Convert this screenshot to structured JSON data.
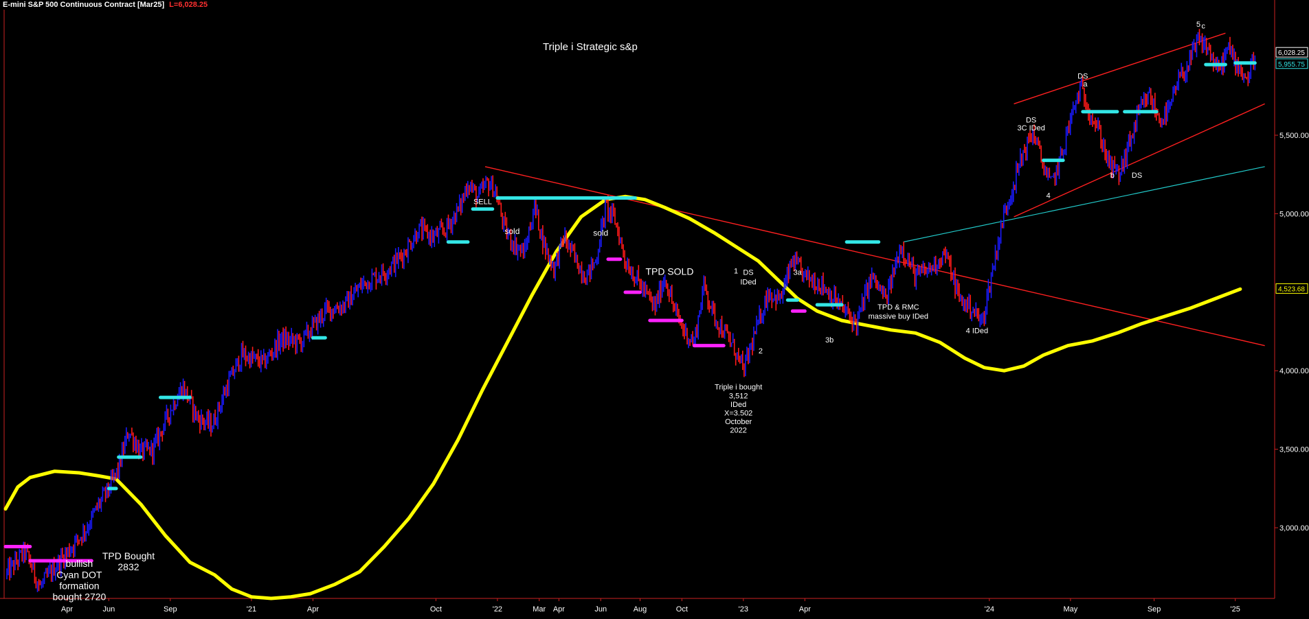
{
  "header": {
    "title": "E-mini S&P 500 Continuous Contract [Mar25]",
    "last_price": "L=6,028.25"
  },
  "colors": {
    "background": "#000000",
    "up_bar": "#1a1aff",
    "down_bar": "#ff1a1a",
    "moving_average": "#ffff00",
    "cyan_dots": "#33e6e6",
    "magenta_dots": "#ff22ff",
    "trendline_red": "#ff2020",
    "trendline_cyan": "#22cccc"
  },
  "chart_data": {
    "type": "line",
    "title": "Triple i Strategic  s&p",
    "xlabel": "",
    "ylabel": "",
    "x_ticks": [
      {
        "label": "Apr",
        "t": 2020.25
      },
      {
        "label": "Jun",
        "t": 2020.42
      },
      {
        "label": "Sep",
        "t": 2020.67
      },
      {
        "label": "'21",
        "t": 2021.0
      },
      {
        "label": "Apr",
        "t": 2021.25
      },
      {
        "label": "Oct",
        "t": 2021.75
      },
      {
        "label": "'22",
        "t": 2022.0
      },
      {
        "label": "Mar",
        "t": 2022.17
      },
      {
        "label": "Apr",
        "t": 2022.25
      },
      {
        "label": "Jun",
        "t": 2022.42
      },
      {
        "label": "Aug",
        "t": 2022.58
      },
      {
        "label": "Oct",
        "t": 2022.75
      },
      {
        "label": "'23",
        "t": 2023.0
      },
      {
        "label": "Apr",
        "t": 2023.25
      },
      {
        "label": "'24",
        "t": 2024.0
      },
      {
        "label": "May",
        "t": 2024.33
      },
      {
        "label": "Sep",
        "t": 2024.67
      },
      {
        "label": "'25",
        "t": 2025.0
      }
    ],
    "y_ticks": [
      {
        "label": "3,000.00",
        "v": 3000
      },
      {
        "label": "3,500.00",
        "v": 3500
      },
      {
        "label": "4,000.00",
        "v": 4000
      },
      {
        "label": "5,000.00",
        "v": 5000
      },
      {
        "label": "5,500.00",
        "v": 5500
      }
    ],
    "price_tags": [
      {
        "label": "6,028.25",
        "v": 6028.25,
        "color": "#ffffff"
      },
      {
        "label": "5,955.75",
        "v": 5955.75,
        "color": "#33e6e6"
      },
      {
        "label": "4,523.68",
        "v": 4523.68,
        "color": "#ffff00"
      }
    ],
    "price_path": [
      {
        "t": 2020.0,
        "v": 2700
      },
      {
        "t": 2020.08,
        "v": 2850
      },
      {
        "t": 2020.14,
        "v": 2620
      },
      {
        "t": 2020.2,
        "v": 2750
      },
      {
        "t": 2020.28,
        "v": 2900
      },
      {
        "t": 2020.33,
        "v": 3000
      },
      {
        "t": 2020.38,
        "v": 3150
      },
      {
        "t": 2020.42,
        "v": 3250
      },
      {
        "t": 2020.46,
        "v": 3380
      },
      {
        "t": 2020.5,
        "v": 3620
      },
      {
        "t": 2020.55,
        "v": 3480
      },
      {
        "t": 2020.6,
        "v": 3500
      },
      {
        "t": 2020.67,
        "v": 3750
      },
      {
        "t": 2020.72,
        "v": 3900
      },
      {
        "t": 2020.78,
        "v": 3700
      },
      {
        "t": 2020.84,
        "v": 3650
      },
      {
        "t": 2020.9,
        "v": 3900
      },
      {
        "t": 2020.96,
        "v": 4100
      },
      {
        "t": 2021.05,
        "v": 4050
      },
      {
        "t": 2021.12,
        "v": 4200
      },
      {
        "t": 2021.2,
        "v": 4180
      },
      {
        "t": 2021.3,
        "v": 4380
      },
      {
        "t": 2021.38,
        "v": 4420
      },
      {
        "t": 2021.45,
        "v": 4550
      },
      {
        "t": 2021.55,
        "v": 4640
      },
      {
        "t": 2021.62,
        "v": 4750
      },
      {
        "t": 2021.68,
        "v": 4900
      },
      {
        "t": 2021.74,
        "v": 4850
      },
      {
        "t": 2021.79,
        "v": 4900
      },
      {
        "t": 2021.85,
        "v": 5050
      },
      {
        "t": 2021.88,
        "v": 5200
      },
      {
        "t": 2021.92,
        "v": 5100
      },
      {
        "t": 2021.96,
        "v": 5200
      },
      {
        "t": 2021.99,
        "v": 5150
      },
      {
        "t": 2022.03,
        "v": 4900
      },
      {
        "t": 2022.07,
        "v": 4800
      },
      {
        "t": 2022.11,
        "v": 4750
      },
      {
        "t": 2022.15,
        "v": 5050
      },
      {
        "t": 2022.19,
        "v": 4800
      },
      {
        "t": 2022.23,
        "v": 4650
      },
      {
        "t": 2022.27,
        "v": 4850
      },
      {
        "t": 2022.32,
        "v": 4700
      },
      {
        "t": 2022.36,
        "v": 4600
      },
      {
        "t": 2022.4,
        "v": 4700
      },
      {
        "t": 2022.44,
        "v": 5050
      },
      {
        "t": 2022.48,
        "v": 4950
      },
      {
        "t": 2022.52,
        "v": 4700
      },
      {
        "t": 2022.56,
        "v": 4600
      },
      {
        "t": 2022.6,
        "v": 4500
      },
      {
        "t": 2022.64,
        "v": 4400
      },
      {
        "t": 2022.68,
        "v": 4600
      },
      {
        "t": 2022.72,
        "v": 4380
      },
      {
        "t": 2022.76,
        "v": 4250
      },
      {
        "t": 2022.8,
        "v": 4180
      },
      {
        "t": 2022.84,
        "v": 4550
      },
      {
        "t": 2022.88,
        "v": 4350
      },
      {
        "t": 2022.92,
        "v": 4250
      },
      {
        "t": 2022.96,
        "v": 4150
      },
      {
        "t": 2023.0,
        "v": 4000
      },
      {
        "t": 2023.05,
        "v": 4250
      },
      {
        "t": 2023.1,
        "v": 4500
      },
      {
        "t": 2023.15,
        "v": 4450
      },
      {
        "t": 2023.2,
        "v": 4700
      },
      {
        "t": 2023.25,
        "v": 4600
      },
      {
        "t": 2023.32,
        "v": 4550
      },
      {
        "t": 2023.4,
        "v": 4400
      },
      {
        "t": 2023.46,
        "v": 4300
      },
      {
        "t": 2023.52,
        "v": 4600
      },
      {
        "t": 2023.58,
        "v": 4450
      },
      {
        "t": 2023.64,
        "v": 4800
      },
      {
        "t": 2023.7,
        "v": 4600
      },
      {
        "t": 2023.76,
        "v": 4650
      },
      {
        "t": 2023.82,
        "v": 4750
      },
      {
        "t": 2023.88,
        "v": 4450
      },
      {
        "t": 2023.93,
        "v": 4400
      },
      {
        "t": 2023.97,
        "v": 4300
      },
      {
        "t": 2024.02,
        "v": 4700
      },
      {
        "t": 2024.06,
        "v": 5000
      },
      {
        "t": 2024.1,
        "v": 5200
      },
      {
        "t": 2024.14,
        "v": 5400
      },
      {
        "t": 2024.18,
        "v": 5520
      },
      {
        "t": 2024.21,
        "v": 5350
      },
      {
        "t": 2024.25,
        "v": 5180
      },
      {
        "t": 2024.29,
        "v": 5350
      },
      {
        "t": 2024.33,
        "v": 5600
      },
      {
        "t": 2024.37,
        "v": 5800
      },
      {
        "t": 2024.41,
        "v": 5650
      },
      {
        "t": 2024.45,
        "v": 5500
      },
      {
        "t": 2024.49,
        "v": 5300
      },
      {
        "t": 2024.53,
        "v": 5250
      },
      {
        "t": 2024.57,
        "v": 5450
      },
      {
        "t": 2024.61,
        "v": 5650
      },
      {
        "t": 2024.65,
        "v": 5750
      },
      {
        "t": 2024.69,
        "v": 5600
      },
      {
        "t": 2024.73,
        "v": 5650
      },
      {
        "t": 2024.77,
        "v": 5850
      },
      {
        "t": 2024.81,
        "v": 5950
      },
      {
        "t": 2024.85,
        "v": 6100
      },
      {
        "t": 2024.89,
        "v": 6050
      },
      {
        "t": 2024.93,
        "v": 5900
      },
      {
        "t": 2024.97,
        "v": 6050
      },
      {
        "t": 2025.01,
        "v": 5950
      },
      {
        "t": 2025.05,
        "v": 5850
      },
      {
        "t": 2025.08,
        "v": 6028
      }
    ],
    "moving_average": [
      {
        "t": 2020.0,
        "v": 3120
      },
      {
        "t": 2020.05,
        "v": 3260
      },
      {
        "t": 2020.1,
        "v": 3320
      },
      {
        "t": 2020.2,
        "v": 3360
      },
      {
        "t": 2020.3,
        "v": 3350
      },
      {
        "t": 2020.38,
        "v": 3330
      },
      {
        "t": 2020.45,
        "v": 3310
      },
      {
        "t": 2020.55,
        "v": 3150
      },
      {
        "t": 2020.65,
        "v": 2950
      },
      {
        "t": 2020.75,
        "v": 2780
      },
      {
        "t": 2020.85,
        "v": 2700
      },
      {
        "t": 2020.92,
        "v": 2610
      },
      {
        "t": 2021.0,
        "v": 2560
      },
      {
        "t": 2021.08,
        "v": 2550
      },
      {
        "t": 2021.16,
        "v": 2560
      },
      {
        "t": 2021.24,
        "v": 2580
      },
      {
        "t": 2021.34,
        "v": 2640
      },
      {
        "t": 2021.44,
        "v": 2720
      },
      {
        "t": 2021.54,
        "v": 2880
      },
      {
        "t": 2021.64,
        "v": 3060
      },
      {
        "t": 2021.74,
        "v": 3280
      },
      {
        "t": 2021.84,
        "v": 3560
      },
      {
        "t": 2021.94,
        "v": 3880
      },
      {
        "t": 2022.04,
        "v": 4180
      },
      {
        "t": 2022.14,
        "v": 4480
      },
      {
        "t": 2022.24,
        "v": 4760
      },
      {
        "t": 2022.34,
        "v": 4980
      },
      {
        "t": 2022.44,
        "v": 5090
      },
      {
        "t": 2022.52,
        "v": 5110
      },
      {
        "t": 2022.6,
        "v": 5090
      },
      {
        "t": 2022.68,
        "v": 5040
      },
      {
        "t": 2022.78,
        "v": 4970
      },
      {
        "t": 2022.88,
        "v": 4880
      },
      {
        "t": 2022.98,
        "v": 4780
      },
      {
        "t": 2023.06,
        "v": 4700
      },
      {
        "t": 2023.14,
        "v": 4580
      },
      {
        "t": 2023.22,
        "v": 4460
      },
      {
        "t": 2023.3,
        "v": 4380
      },
      {
        "t": 2023.4,
        "v": 4320
      },
      {
        "t": 2023.5,
        "v": 4290
      },
      {
        "t": 2023.6,
        "v": 4260
      },
      {
        "t": 2023.7,
        "v": 4240
      },
      {
        "t": 2023.8,
        "v": 4180
      },
      {
        "t": 2023.9,
        "v": 4080
      },
      {
        "t": 2023.98,
        "v": 4020
      },
      {
        "t": 2024.06,
        "v": 4000
      },
      {
        "t": 2024.14,
        "v": 4030
      },
      {
        "t": 2024.22,
        "v": 4100
      },
      {
        "t": 2024.32,
        "v": 4160
      },
      {
        "t": 2024.42,
        "v": 4190
      },
      {
        "t": 2024.52,
        "v": 4240
      },
      {
        "t": 2024.62,
        "v": 4300
      },
      {
        "t": 2024.72,
        "v": 4350
      },
      {
        "t": 2024.82,
        "v": 4400
      },
      {
        "t": 2024.92,
        "v": 4460
      },
      {
        "t": 2025.02,
        "v": 4520
      }
    ],
    "cyan_levels": [
      {
        "t1": 2020.42,
        "t2": 2020.45,
        "v": 3250
      },
      {
        "t1": 2020.46,
        "t2": 2020.55,
        "v": 3450
      },
      {
        "t1": 2020.63,
        "t2": 2020.75,
        "v": 3830
      },
      {
        "t1": 2021.25,
        "t2": 2021.3,
        "v": 4210
      },
      {
        "t1": 2021.8,
        "t2": 2021.88,
        "v": 4820
      },
      {
        "t1": 2021.9,
        "t2": 2021.98,
        "v": 5030
      },
      {
        "t1": 2022.0,
        "t2": 2022.56,
        "v": 5100
      },
      {
        "t1": 2023.18,
        "t2": 2023.22,
        "v": 4450
      },
      {
        "t1": 2023.3,
        "t2": 2023.4,
        "v": 4420
      },
      {
        "t1": 2023.42,
        "t2": 2023.55,
        "v": 4820
      },
      {
        "t1": 2024.22,
        "t2": 2024.3,
        "v": 5340
      },
      {
        "t1": 2024.38,
        "t2": 2024.52,
        "v": 5650
      },
      {
        "t1": 2024.55,
        "t2": 2024.68,
        "v": 5650
      },
      {
        "t1": 2024.88,
        "t2": 2024.96,
        "v": 5950
      },
      {
        "t1": 2025.0,
        "t2": 2025.08,
        "v": 5960
      }
    ],
    "magenta_levels": [
      {
        "t1": 2020.0,
        "t2": 2020.1,
        "v": 2880
      },
      {
        "t1": 2020.1,
        "t2": 2020.35,
        "v": 2790
      },
      {
        "t1": 2022.45,
        "t2": 2022.5,
        "v": 4710
      },
      {
        "t1": 2022.52,
        "t2": 2022.58,
        "v": 4500
      },
      {
        "t1": 2022.62,
        "t2": 2022.75,
        "v": 4320
      },
      {
        "t1": 2022.8,
        "t2": 2022.92,
        "v": 4160
      },
      {
        "t1": 2023.2,
        "t2": 2023.25,
        "v": 4380
      }
    ],
    "trendlines": [
      {
        "color": "red",
        "t1": 2021.95,
        "v1": 5300,
        "t2": 2025.12,
        "v2": 4160
      },
      {
        "color": "red",
        "t1": 2024.1,
        "v1": 5700,
        "t2": 2024.96,
        "v2": 6150
      },
      {
        "color": "red",
        "t1": 2024.1,
        "v1": 4980,
        "t2": 2025.12,
        "v2": 5700
      },
      {
        "color": "cyan",
        "t1": 2023.65,
        "v1": 4820,
        "t2": 2025.12,
        "v2": 5300
      }
    ],
    "annotations": [
      {
        "text": "SELL",
        "t": 2021.94,
        "v": 5060,
        "size": 11
      },
      {
        "text": "sold",
        "t": 2022.06,
        "v": 4870,
        "size": 12
      },
      {
        "text": "sold",
        "t": 2022.42,
        "v": 4860,
        "size": 12
      },
      {
        "text": "TPD  SOLD",
        "t": 2022.7,
        "v": 4610,
        "size": 14
      },
      {
        "text": "Triple i bought",
        "t": 2022.98,
        "v": 3880,
        "size": 11
      },
      {
        "text": "3,512",
        "t": 2022.98,
        "v": 3825,
        "size": 11
      },
      {
        "text": "IDed",
        "t": 2022.98,
        "v": 3770,
        "size": 11
      },
      {
        "text": "X=3.502",
        "t": 2022.98,
        "v": 3715,
        "size": 11
      },
      {
        "text": "October",
        "t": 2022.98,
        "v": 3660,
        "size": 11
      },
      {
        "text": "2022",
        "t": 2022.98,
        "v": 3605,
        "size": 11
      },
      {
        "text": "1",
        "t": 2022.97,
        "v": 4620,
        "size": 11
      },
      {
        "text": "DS",
        "t": 2023.02,
        "v": 4610,
        "size": 11
      },
      {
        "text": "IDed",
        "t": 2023.02,
        "v": 4550,
        "size": 11
      },
      {
        "text": "2",
        "t": 2023.07,
        "v": 4110,
        "size": 11
      },
      {
        "text": "3a",
        "t": 2023.22,
        "v": 4610,
        "size": 11
      },
      {
        "text": "3b",
        "t": 2023.35,
        "v": 4180,
        "size": 11
      },
      {
        "text": "TPD & RMC",
        "t": 2023.63,
        "v": 4390,
        "size": 11
      },
      {
        "text": "massive buy IDed",
        "t": 2023.63,
        "v": 4330,
        "size": 11
      },
      {
        "text": "4 IDed",
        "t": 2023.95,
        "v": 4240,
        "size": 11
      },
      {
        "text": "DS",
        "t": 2024.17,
        "v": 5580,
        "size": 11
      },
      {
        "text": "3C IDed",
        "t": 2024.17,
        "v": 5530,
        "size": 11
      },
      {
        "text": "4",
        "t": 2024.24,
        "v": 5100,
        "size": 11
      },
      {
        "text": "DS",
        "t": 2024.38,
        "v": 5860,
        "size": 11
      },
      {
        "text": "a",
        "t": 2024.39,
        "v": 5810,
        "size": 11
      },
      {
        "text": "b",
        "t": 2024.5,
        "v": 5230,
        "size": 11
      },
      {
        "text": "DS",
        "t": 2024.6,
        "v": 5230,
        "size": 11
      },
      {
        "text": "5",
        "t": 2024.85,
        "v": 6190,
        "size": 11
      },
      {
        "text": "c",
        "t": 2024.87,
        "v": 6180,
        "size": 11
      },
      {
        "text": "TPD Bought",
        "t": 2020.5,
        "v": 2800,
        "size": 14
      },
      {
        "text": "2832",
        "t": 2020.5,
        "v": 2730,
        "size": 14
      },
      {
        "text": "bullish",
        "t": 2020.3,
        "v": 2750,
        "size": 14
      },
      {
        "text": "Cyan DOT",
        "t": 2020.3,
        "v": 2680,
        "size": 14
      },
      {
        "text": "formation",
        "t": 2020.3,
        "v": 2610,
        "size": 14
      },
      {
        "text": "bought 2720",
        "t": 2020.3,
        "v": 2540,
        "size": 14
      }
    ],
    "x_range": [
      2020.0,
      2025.16
    ],
    "ylim": [
      2550,
      6300
    ],
    "grid": false,
    "legend": "none"
  }
}
